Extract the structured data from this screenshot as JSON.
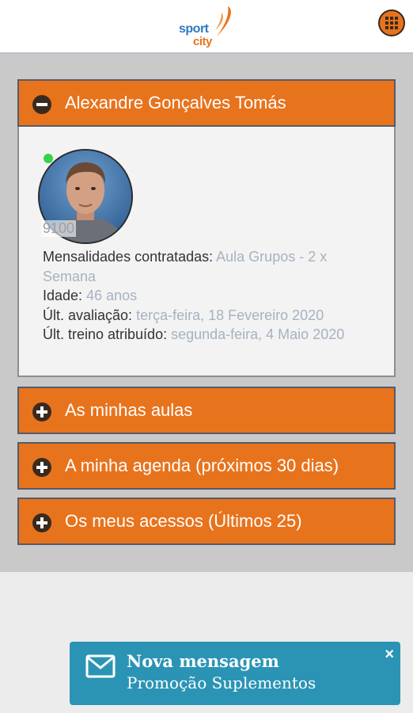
{
  "header": {
    "logo_line1": "sport",
    "logo_line2": "city",
    "menu_icon": "grid-menu-icon"
  },
  "profile": {
    "name": "Alexandre Gonçalves Tomás",
    "member_id": "9100",
    "online": true,
    "fields": [
      {
        "label": "Mensalidades contratadas:",
        "value": "Aula Grupos - 2 x Semana"
      },
      {
        "label": "Idade:",
        "value": "46 anos"
      },
      {
        "label": "Últ. avaliação:",
        "value": "terça-feira, 18 Fevereiro 2020"
      },
      {
        "label": "Últ. treino atribuído:",
        "value": "segunda-feira, 4 Maio 2020"
      }
    ]
  },
  "sections": [
    {
      "label": "As minhas aulas"
    },
    {
      "label": "A minha agenda (próximos 30 dias)"
    },
    {
      "label": "Os meus acessos (Últimos 25)"
    }
  ],
  "toast": {
    "title": "Nova mensagem",
    "message": "Promoção Suplementos",
    "close": "×"
  },
  "colors": {
    "accent": "#e8731d",
    "toast": "#2b94b5",
    "value_text": "#a7b2c0"
  }
}
